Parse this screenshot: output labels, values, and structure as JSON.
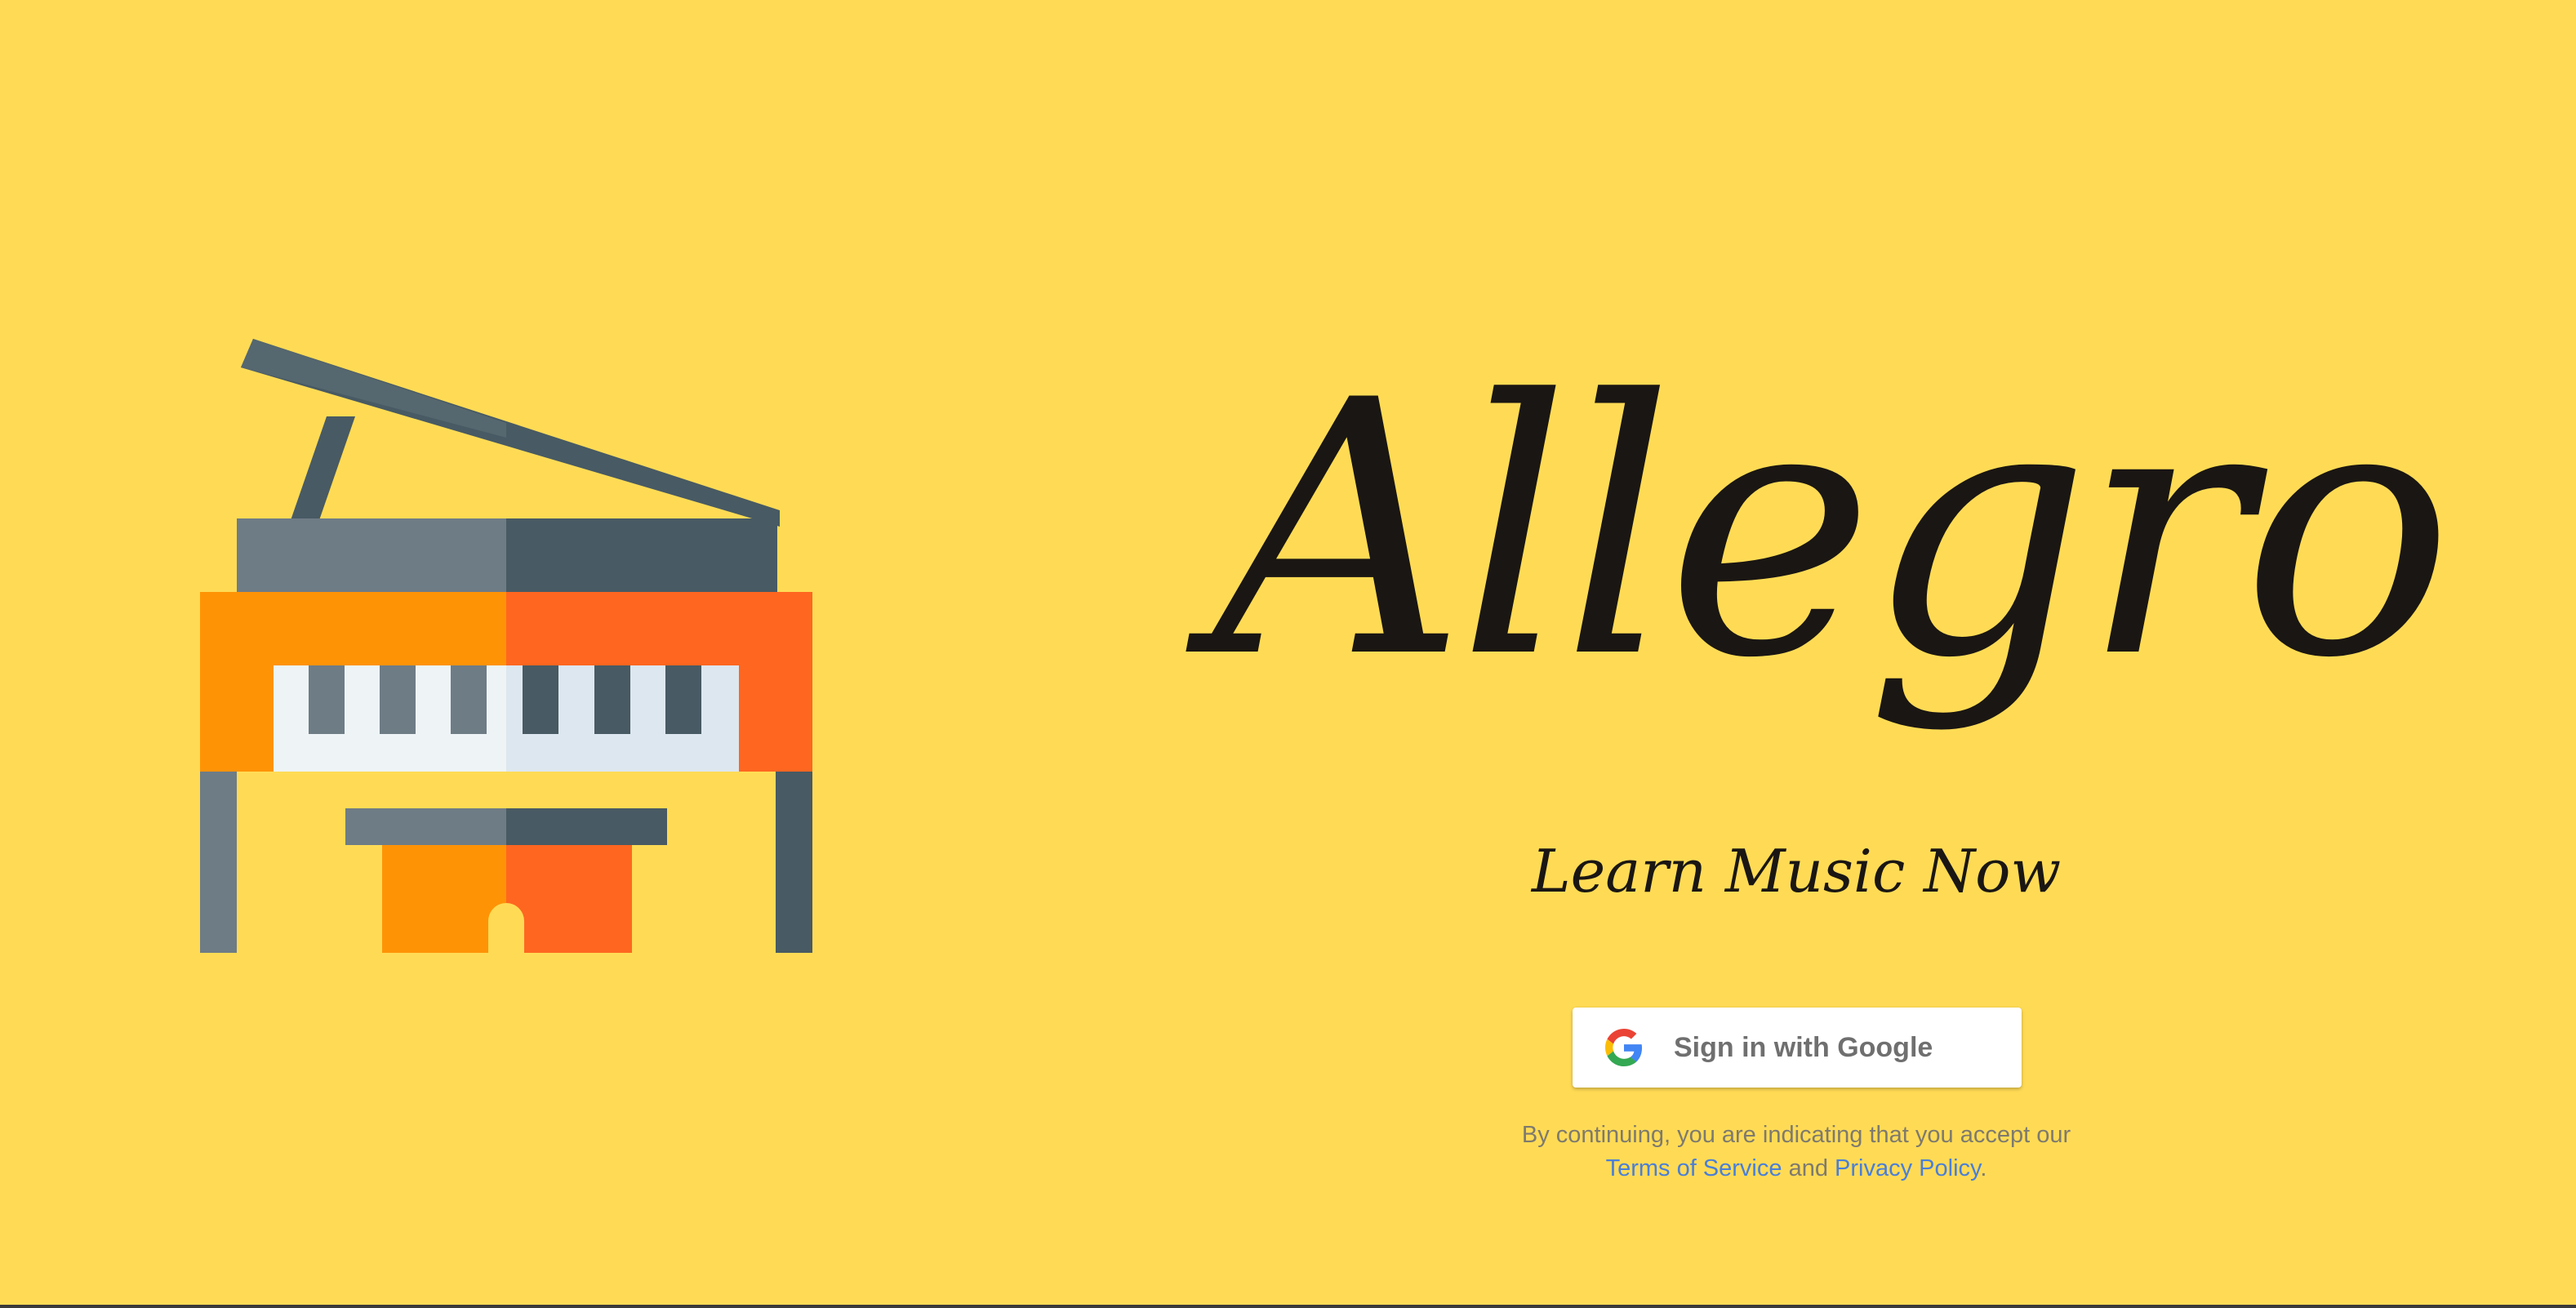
{
  "app": {
    "title": "Allegro",
    "tagline": "Learn Music Now"
  },
  "colors": {
    "background": "#FFDB55",
    "title_ink": "#1a1613",
    "link": "#4a7fd8",
    "piano_orange_light": "#FF9306",
    "piano_orange_dark": "#FF6620",
    "piano_gray_light": "#6E7C86",
    "piano_gray_dark": "#485A63"
  },
  "illustration": {
    "icon": "grand-piano-icon"
  },
  "signin": {
    "label": "Sign in with Google",
    "icon": "google-g-icon"
  },
  "legal": {
    "prefix": "By continuing, you are indicating that you accept our",
    "terms_label": "Terms of Service",
    "conjunction": "and",
    "privacy_label": "Privacy Policy",
    "suffix": "."
  }
}
